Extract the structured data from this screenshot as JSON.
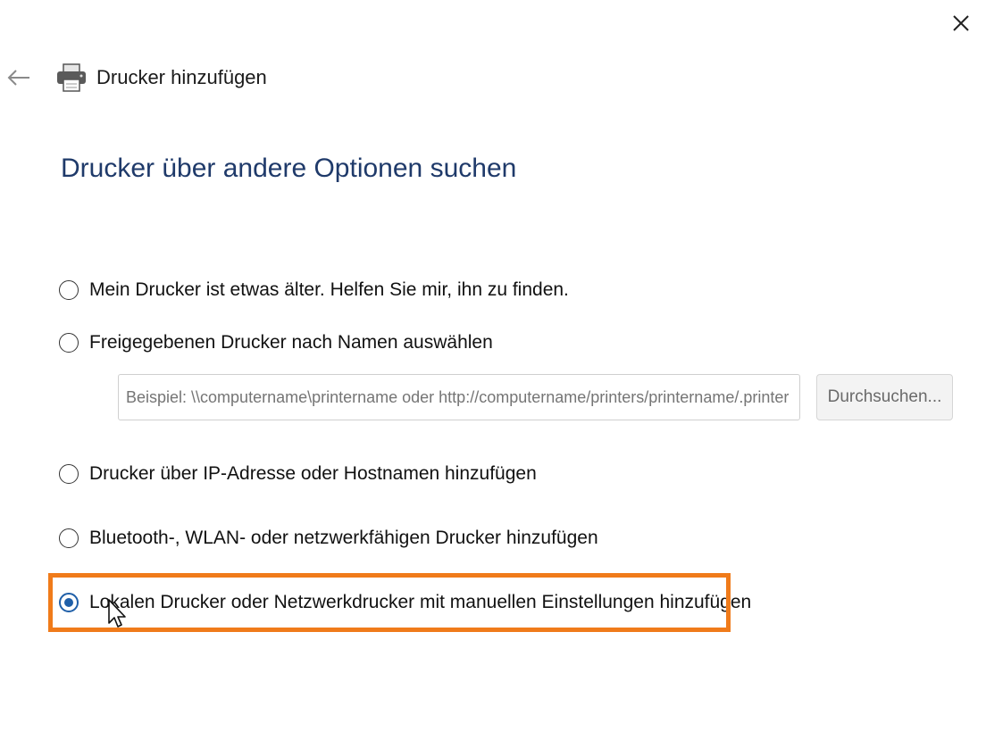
{
  "window": {
    "title": "Drucker hinzufügen",
    "close_icon": "close-icon",
    "back_icon": "back-arrow-icon",
    "app_icon": "printer-icon"
  },
  "page": {
    "heading": "Drucker über andere Optionen suchen"
  },
  "options": [
    {
      "label": "Mein Drucker ist etwas älter. Helfen Sie mir, ihn zu finden.",
      "selected": false
    },
    {
      "label": "Freigegebenen Drucker nach Namen auswählen",
      "selected": false
    },
    {
      "label": "Drucker über IP-Adresse oder Hostnamen hinzufügen",
      "selected": false
    },
    {
      "label": "Bluetooth-, WLAN- oder netzwerkfähigen Drucker hinzufügen",
      "selected": false
    },
    {
      "label": "Lokalen Drucker oder Netzwerkdrucker mit manuellen Einstellungen hinzufügen",
      "selected": true
    }
  ],
  "shared_printer": {
    "placeholder": "Beispiel: \\\\computername\\printername oder http://computername/printers/printername/.printer",
    "value": "",
    "browse_label": "Durchsuchen..."
  },
  "colors": {
    "heading": "#1f3a6a",
    "radio_selected": "#1f5fa8",
    "highlight_border": "#f07b1a"
  }
}
